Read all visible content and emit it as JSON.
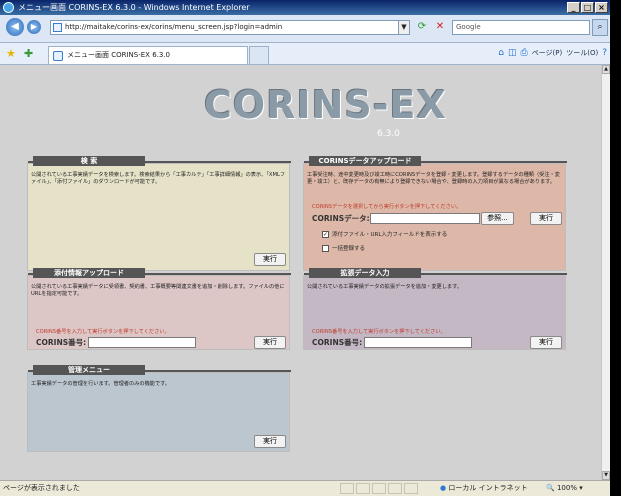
{
  "window": {
    "title": "メニュー画面 CORINS-EX 6.3.0 - Windows Internet Explorer",
    "minimize": "_",
    "maximize": "□",
    "close": "×"
  },
  "address": {
    "url": "http://maitake/corins-ex/corins/menu_screen.jsp?login=admin",
    "search_placeholder": "Google"
  },
  "tab": {
    "label": "メニュー画面 CORINS-EX 6.3.0"
  },
  "commands": {
    "page": "ページ(P)",
    "tools": "ツール(O)"
  },
  "app": {
    "logo": "CORINS-EX",
    "version": "6.3.0"
  },
  "panels": {
    "search": {
      "title": "検 索",
      "desc": "公開されている工事実績データを検索します。検索結果から「工事カルテ」「工事詳細情報」の表示、「XMLファイル」、「添付ファイル」のダウンロードが可能です。",
      "run": "実行"
    },
    "upload": {
      "title": "CORINSデータアップロード",
      "desc": "工事受注時、途中変更時及び竣工時にCORINSデータを登録・変更します。登録するデータの種類（受注・変更・竣工）と、既存データの有無により登録できない場合や、登録時の入力項目が異なる場合があります。",
      "hint": "CORINSデータを選択してから実行ボタンを押下してください。",
      "field_label": "CORINSデータ:",
      "browse": "参照...",
      "run": "実行",
      "check1": "添付ファイル・URL入力フィールドを表示する",
      "check2": "一括登録する"
    },
    "attach": {
      "title": "添付情報アップロード",
      "desc": "公開されている工事実績データに受領書、契約書、工事概要等関連文書を追加・削除します。ファイルの他にURLを指定可能です。",
      "hint": "CORINS番号を入力して実行ボタンを押下してください。",
      "field_label": "CORINS番号:",
      "run": "実行"
    },
    "extend": {
      "title": "拡張データ入力",
      "desc": "公開されている工事実績データの拡張データを追加・変更します。",
      "hint": "CORINS番号を入力して実行ボタンを押下してください。",
      "field_label": "CORINS番号:",
      "run": "実行"
    },
    "admin": {
      "title": "管理メニュー",
      "desc": "工事実績データの管理を行います。管理者のみの機能です。",
      "run": "実行"
    }
  },
  "status": {
    "text": "ページが表示されました",
    "zone": "ローカル イントラネット",
    "zoom": "100%"
  }
}
